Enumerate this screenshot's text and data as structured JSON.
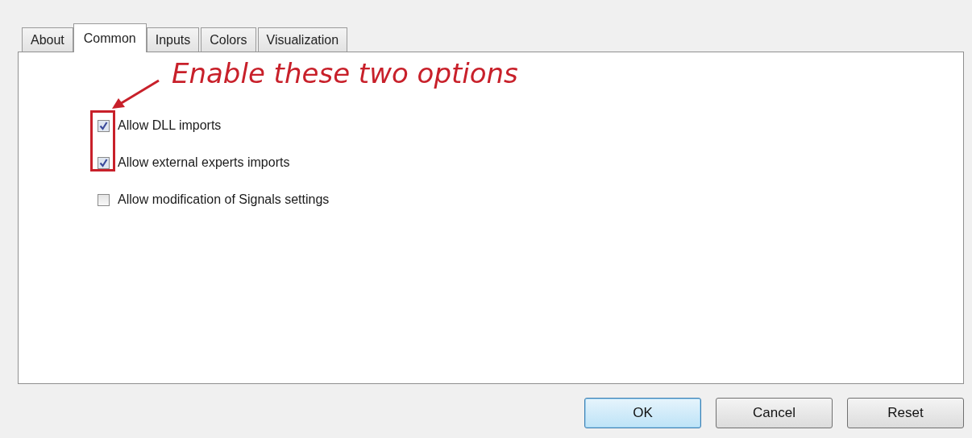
{
  "tabs": [
    {
      "label": "About",
      "selected": false
    },
    {
      "label": "Common",
      "selected": true
    },
    {
      "label": "Inputs",
      "selected": false
    },
    {
      "label": "Colors",
      "selected": false
    },
    {
      "label": "Visualization",
      "selected": false
    }
  ],
  "annotation": {
    "text": "Enable these two options"
  },
  "options": [
    {
      "label": "Allow DLL imports",
      "checked": true,
      "highlighted": true
    },
    {
      "label": "Allow external experts imports",
      "checked": true,
      "highlighted": true
    },
    {
      "label": "Allow modification of Signals settings",
      "checked": false,
      "highlighted": false
    }
  ],
  "buttons": [
    {
      "label": "OK",
      "focused": true
    },
    {
      "label": "Cancel",
      "focused": false
    },
    {
      "label": "Reset",
      "focused": false
    }
  ]
}
